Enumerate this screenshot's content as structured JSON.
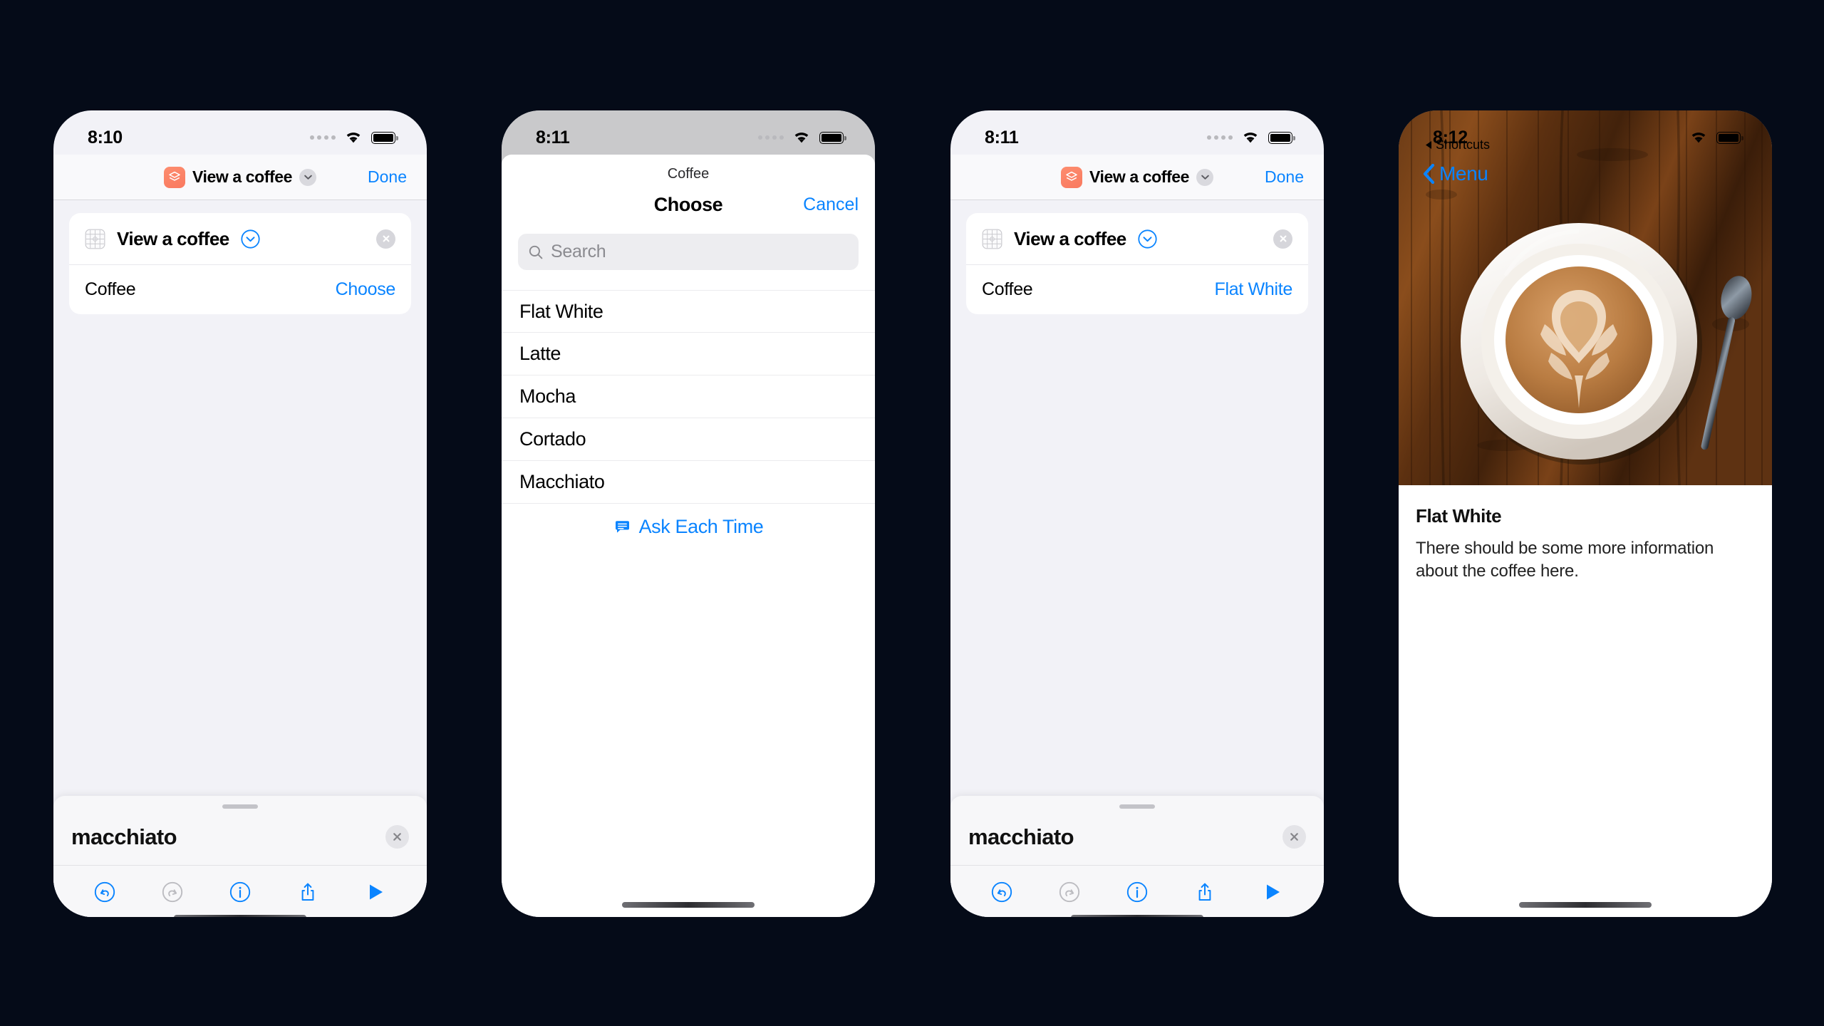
{
  "background_color": "#050b18",
  "accent_color": "#0a84ff",
  "app_icon_color": "#fb7f62",
  "phone1": {
    "name": "shortcut-editor-unset",
    "status": {
      "time": "8:10",
      "signal": "signal-dots-icon",
      "wifi": "wifi-icon",
      "battery": "battery-icon"
    },
    "header": {
      "app_icon": "shortcuts-app-icon",
      "title": "View a coffee",
      "chevron": "chevron-down-icon",
      "done": "Done"
    },
    "card": {
      "icon": "app-grid-icon",
      "title": "View a coffee",
      "chevron": "chevron-down-circle-icon",
      "close": "close-circle-icon",
      "row_label": "Coffee",
      "row_value": "Choose"
    },
    "sheet": {
      "name": "macchiato",
      "close": "close-circle-icon",
      "toolbar": [
        "undo-icon",
        "redo-icon",
        "info-icon",
        "share-icon",
        "play-icon"
      ]
    }
  },
  "phone2": {
    "name": "choose-coffee-modal",
    "status": {
      "time": "8:11",
      "signal": "signal-dots-icon",
      "wifi": "wifi-icon",
      "battery": "battery-icon"
    },
    "modal": {
      "context_title": "Coffee",
      "nav_title": "Choose",
      "cancel": "Cancel",
      "search_placeholder": "Search",
      "search_icon": "search-icon",
      "options": [
        "Flat White",
        "Latte",
        "Mocha",
        "Cortado",
        "Macchiato"
      ],
      "ask_each_time": {
        "icon": "speech-bubble-icon",
        "label": "Ask Each Time"
      }
    }
  },
  "phone3": {
    "name": "shortcut-editor-selected",
    "status": {
      "time": "8:11",
      "signal": "signal-dots-icon",
      "wifi": "wifi-icon",
      "battery": "battery-icon"
    },
    "header": {
      "app_icon": "shortcuts-app-icon",
      "title": "View a coffee",
      "chevron": "chevron-down-icon",
      "done": "Done"
    },
    "card": {
      "icon": "app-grid-icon",
      "title": "View a coffee",
      "chevron": "chevron-down-circle-icon",
      "close": "close-circle-icon",
      "row_label": "Coffee",
      "row_value": "Flat White"
    },
    "sheet": {
      "name": "macchiato",
      "close": "close-circle-icon",
      "toolbar": [
        "undo-icon",
        "redo-icon",
        "info-icon",
        "share-icon",
        "play-icon"
      ]
    }
  },
  "phone4": {
    "name": "coffee-detail-view",
    "status": {
      "time": "8:12",
      "wifi": "wifi-icon",
      "battery": "battery-icon"
    },
    "carrier_back": "Shortcuts",
    "back_button": "Menu",
    "photo_alt": "latte-art-coffee-cup-photo",
    "heading": "Flat White",
    "paragraph": "There should be some more information about the coffee here."
  }
}
